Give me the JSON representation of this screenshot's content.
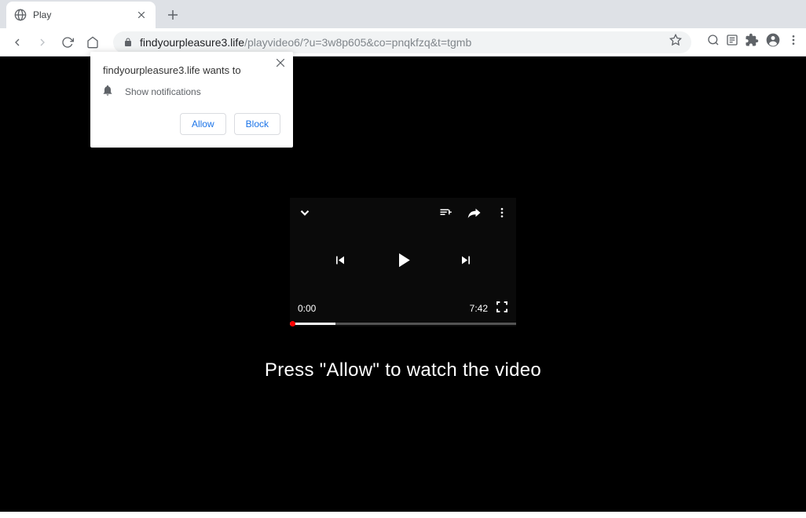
{
  "window": {
    "tab_title": "Play"
  },
  "address": {
    "domain": "findyourpleasure3.life",
    "path": "/playvideo6/?u=3w8p605&co=pnqkfzq&t=tgmb"
  },
  "permission": {
    "title": "findyourpleasure3.life wants to",
    "body": "Show notifications",
    "allow": "Allow",
    "block": "Block"
  },
  "player": {
    "current_time": "0:00",
    "duration": "7:42"
  },
  "page": {
    "instruction": "Press \"Allow\" to watch the video"
  }
}
